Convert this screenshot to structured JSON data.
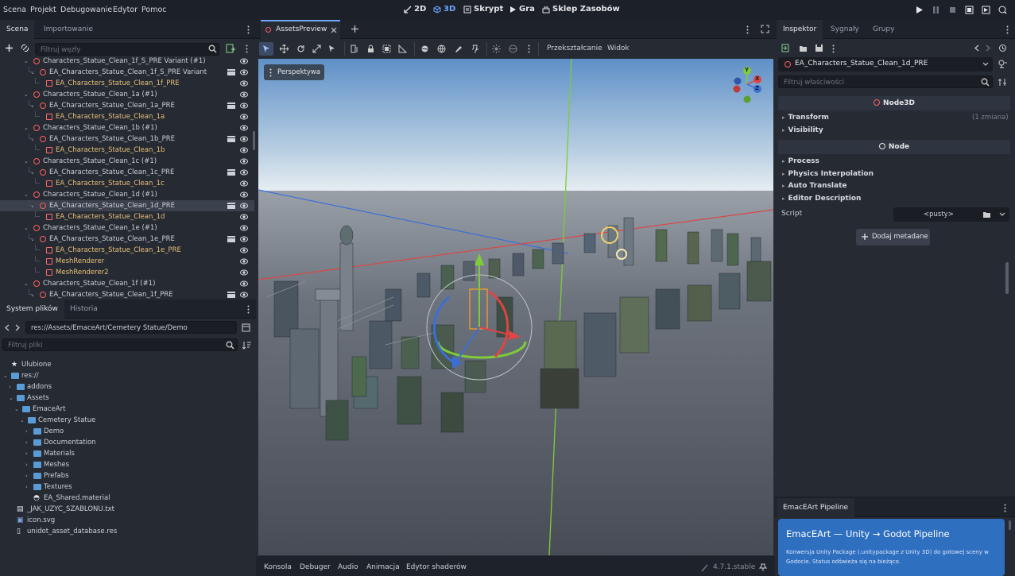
{
  "menu": [
    "Scena",
    "Projekt",
    "Debugowanie",
    "Edytor",
    "Pomoc"
  ],
  "modes": [
    {
      "label": "2D",
      "active": false
    },
    {
      "label": "3D",
      "active": true
    },
    {
      "label": "Skrypt",
      "active": false
    },
    {
      "label": "Gra",
      "active": false
    },
    {
      "label": "Sklep Zasobów",
      "active": false
    }
  ],
  "scene_panel": {
    "tabs": [
      "Scena",
      "Importowanie"
    ],
    "filter_placeholder": "Filtruj węzły",
    "tree": [
      {
        "label": "Characters_Statue_Clean_1f_S_PRE Variant (#1)",
        "type": "node",
        "depth": 0
      },
      {
        "label": "EA_Characters_Statue_Clean_1f_S_PRE Variant",
        "type": "node",
        "depth": 1,
        "clap": true
      },
      {
        "label": "EA_Characters_Statue_Clean_1f_PRE",
        "type": "mesh",
        "depth": 2
      },
      {
        "label": "Characters_Statue_Clean_1a (#1)",
        "type": "node",
        "depth": 0
      },
      {
        "label": "EA_Characters_Statue_Clean_1a_PRE",
        "type": "node",
        "depth": 1,
        "clap": true
      },
      {
        "label": "EA_Characters_Statue_Clean_1a",
        "type": "mesh",
        "depth": 2
      },
      {
        "label": "Characters_Statue_Clean_1b (#1)",
        "type": "node",
        "depth": 0
      },
      {
        "label": "EA_Characters_Statue_Clean_1b_PRE",
        "type": "node",
        "depth": 1,
        "clap": true
      },
      {
        "label": "EA_Characters_Statue_Clean_1b",
        "type": "mesh",
        "depth": 2
      },
      {
        "label": "Characters_Statue_Clean_1c (#1)",
        "type": "node",
        "depth": 0
      },
      {
        "label": "EA_Characters_Statue_Clean_1c_PRE",
        "type": "node",
        "depth": 1,
        "clap": true
      },
      {
        "label": "EA_Characters_Statue_Clean_1c",
        "type": "mesh",
        "depth": 2
      },
      {
        "label": "Characters_Statue_Clean_1d (#1)",
        "type": "node",
        "depth": 0
      },
      {
        "label": "EA_Characters_Statue_Clean_1d_PRE",
        "type": "node",
        "depth": 1,
        "clap": true,
        "selected": true
      },
      {
        "label": "EA_Characters_Statue_Clean_1d",
        "type": "mesh",
        "depth": 2
      },
      {
        "label": "Characters_Statue_Clean_1e (#1)",
        "type": "node",
        "depth": 0
      },
      {
        "label": "EA_Characters_Statue_Clean_1e_PRE",
        "type": "node",
        "depth": 1,
        "clap": true
      },
      {
        "label": "EA_Characters_Statue_Clean_1e_PRE",
        "type": "mesh",
        "depth": 2
      },
      {
        "label": "MeshRenderer",
        "type": "mesh",
        "depth": 2
      },
      {
        "label": "MeshRenderer2",
        "type": "mesh",
        "depth": 2
      },
      {
        "label": "Characters_Statue_Clean_1f (#1)",
        "type": "node",
        "depth": 0
      },
      {
        "label": "EA_Characters_Statue_Clean_1f_PRE",
        "type": "node",
        "depth": 1,
        "clap": true
      }
    ]
  },
  "filesystem": {
    "tabs": [
      "System plików",
      "Historia"
    ],
    "path": "res://Assets/EmaceArt/Cemetery Statue/Demo",
    "filter_placeholder": "Filtruj pliki",
    "items": [
      {
        "label": "Ulubione",
        "icon": "star",
        "depth": 0
      },
      {
        "label": "res://",
        "icon": "folder",
        "depth": 0,
        "open": true
      },
      {
        "label": "addons",
        "icon": "folder",
        "depth": 1
      },
      {
        "label": "Assets",
        "icon": "folder",
        "depth": 1,
        "open": true
      },
      {
        "label": "EmaceArt",
        "icon": "folder",
        "depth": 2,
        "open": true
      },
      {
        "label": "Cemetery Statue",
        "icon": "folder",
        "depth": 3,
        "open": true
      },
      {
        "label": "Demo",
        "icon": "folder",
        "depth": 4
      },
      {
        "label": "Documentation",
        "icon": "folder",
        "depth": 4
      },
      {
        "label": "Materials",
        "icon": "folder",
        "depth": 4
      },
      {
        "label": "Meshes",
        "icon": "folder",
        "depth": 4
      },
      {
        "label": "Prefabs",
        "icon": "folder",
        "depth": 4
      },
      {
        "label": "Textures",
        "icon": "folder",
        "depth": 4
      },
      {
        "label": "EA_Shared.material",
        "icon": "material",
        "depth": 4
      },
      {
        "label": "_JAK_UZYC_SZABLONU.txt",
        "icon": "text",
        "depth": 1
      },
      {
        "label": "icon.svg",
        "icon": "image",
        "depth": 1
      },
      {
        "label": "unidot_asset_database.res",
        "icon": "file",
        "depth": 1
      }
    ]
  },
  "viewport": {
    "tab": "AssetsPreview",
    "toolbar_text": [
      "Przekształcanie",
      "Widok"
    ],
    "perspective_label": "Perspektywa",
    "gizmo_axes": [
      "Y",
      "X",
      "Z"
    ]
  },
  "inspector": {
    "tabs": [
      "Inspektor",
      "Sygnały",
      "Grupy"
    ],
    "node_name": "EA_Characters_Statue_Clean_1d_PRE",
    "filter_placeholder": "Filtruj właściwości",
    "class_node3d": "Node3D",
    "node3d_props": [
      {
        "label": "Transform",
        "note": "(1 zmiana)"
      },
      {
        "label": "Visibility",
        "note": ""
      }
    ],
    "class_node": "Node",
    "node_props": [
      "Process",
      "Physics Interpolation",
      "Auto Translate",
      "Editor Description"
    ],
    "script_label": "Script",
    "script_value": "<pusty>",
    "add_metadata": "Dodaj metadane"
  },
  "pipeline": {
    "tab": "EmacEArt Pipeline",
    "title": "EmacEArt — Unity → Godot Pipeline",
    "desc": "Konwersja Unity Package (.unitypackage z Unity 3D) do gotowej sceny w Godocie. Status odświeża się na bieżąco."
  },
  "bottom_tabs": [
    "Konsola",
    "Debuger",
    "Audio",
    "Animacja",
    "Edytor shaderów"
  ],
  "version": "4.7.1.stable",
  "colors": {
    "accent": "#6ea8ff",
    "node_red": "#ff5f5f",
    "mesh_label": "#e8c179",
    "pipeline_bg": "#2f6fc0"
  }
}
